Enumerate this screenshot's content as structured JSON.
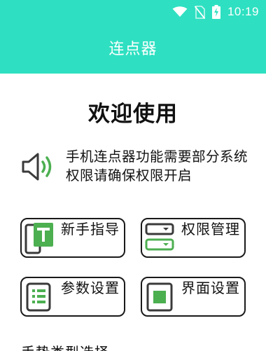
{
  "status_bar": {
    "time": "10:19",
    "icons": [
      "wifi-icon",
      "no-sim-icon",
      "battery-charging-icon"
    ]
  },
  "header": {
    "title": "连点器"
  },
  "colors": {
    "accent": "#2ee0c1",
    "icon_green": "#4caf50",
    "icon_dark": "#3a3a3a"
  },
  "main": {
    "welcome": "欢迎使用",
    "notice": {
      "icon": "speaker-icon",
      "text": "手机连点器功能需要部分系统权限请确保权限开启"
    },
    "buttons": [
      {
        "label": "新手指导",
        "icon": "guide-icon"
      },
      {
        "label": "权限管理",
        "icon": "permission-icon"
      },
      {
        "label": "参数设置",
        "icon": "params-icon"
      },
      {
        "label": "界面设置",
        "icon": "ui-settings-icon"
      }
    ],
    "section_title": "手势类型选择"
  }
}
